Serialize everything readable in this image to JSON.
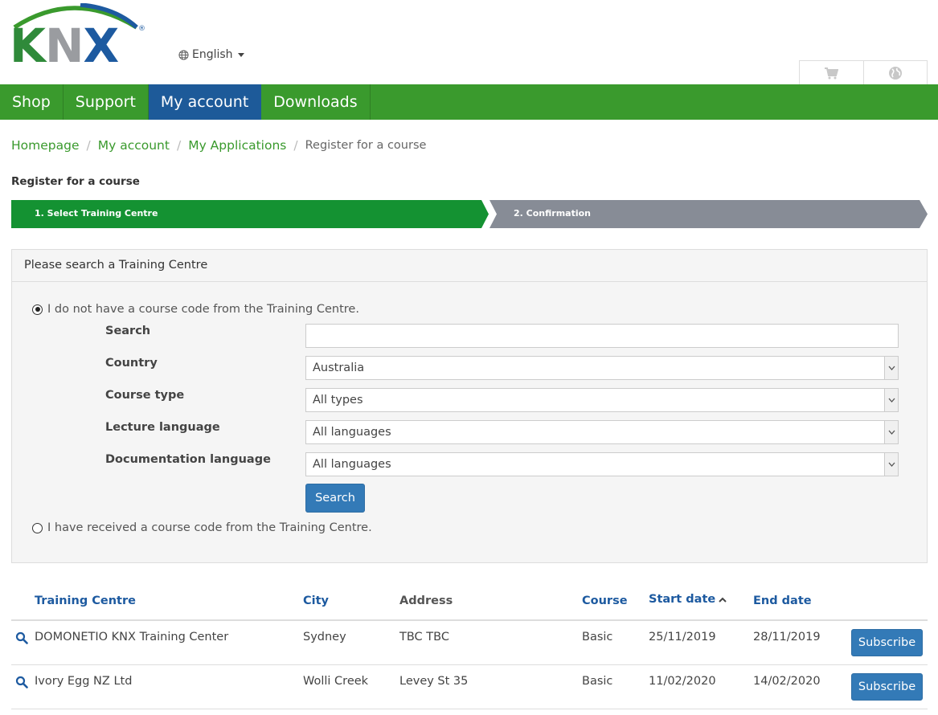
{
  "header": {
    "logo_text": "KNX",
    "language": "English",
    "cart_icon": "cart-icon",
    "globe_icon": "globe-icon"
  },
  "nav": [
    {
      "label": "Shop",
      "active": false
    },
    {
      "label": "Support",
      "active": false
    },
    {
      "label": "My account",
      "active": true
    },
    {
      "label": "Downloads",
      "active": false
    }
  ],
  "breadcrumb": {
    "items": [
      "Homepage",
      "My account",
      "My Applications"
    ],
    "current": "Register for a course",
    "separator": "/"
  },
  "page_title": "Register for a course",
  "steps": [
    {
      "label": "1. Select Training Centre",
      "active": true
    },
    {
      "label": "2. Confirmation",
      "active": false
    }
  ],
  "panel": {
    "title": "Please search a Training Centre",
    "option_no_code": "I do not have a course code from the Training Centre.",
    "option_no_code_selected": true,
    "option_have_code": "I have received a course code from the Training Centre.",
    "option_have_code_selected": false,
    "fields": {
      "search_label": "Search",
      "search_value": "",
      "country_label": "Country",
      "country_value": "Australia",
      "course_type_label": "Course type",
      "course_type_value": "All types",
      "lecture_language_label": "Lecture language",
      "lecture_language_value": "All languages",
      "doc_language_label": "Documentation language",
      "doc_language_value": "All languages"
    },
    "search_button": "Search"
  },
  "table": {
    "headers": {
      "training_centre": "Training Centre",
      "city": "City",
      "address": "Address",
      "course": "Course",
      "start_date": "Start date",
      "end_date": "End date"
    },
    "sort_column": "start_date",
    "sort_direction": "ascending",
    "rows": [
      {
        "training_centre": "DOMONETIO KNX Training Center",
        "city": "Sydney",
        "address": "TBC TBC",
        "course": "Basic",
        "start_date": "25/11/2019",
        "end_date": "28/11/2019",
        "action": "Subscribe"
      },
      {
        "training_centre": "Ivory Egg NZ Ltd",
        "city": "Wolli Creek",
        "address": "Levey St 35",
        "course": "Basic",
        "start_date": "11/02/2020",
        "end_date": "14/02/2020",
        "action": "Subscribe"
      }
    ]
  },
  "colors": {
    "brand_green": "#3a9a2d",
    "step_active": "#149232",
    "step_inactive": "#878c96",
    "nav_active": "#1d5a99",
    "button_blue": "#337ab7",
    "link_blue": "#1d5aa0"
  }
}
